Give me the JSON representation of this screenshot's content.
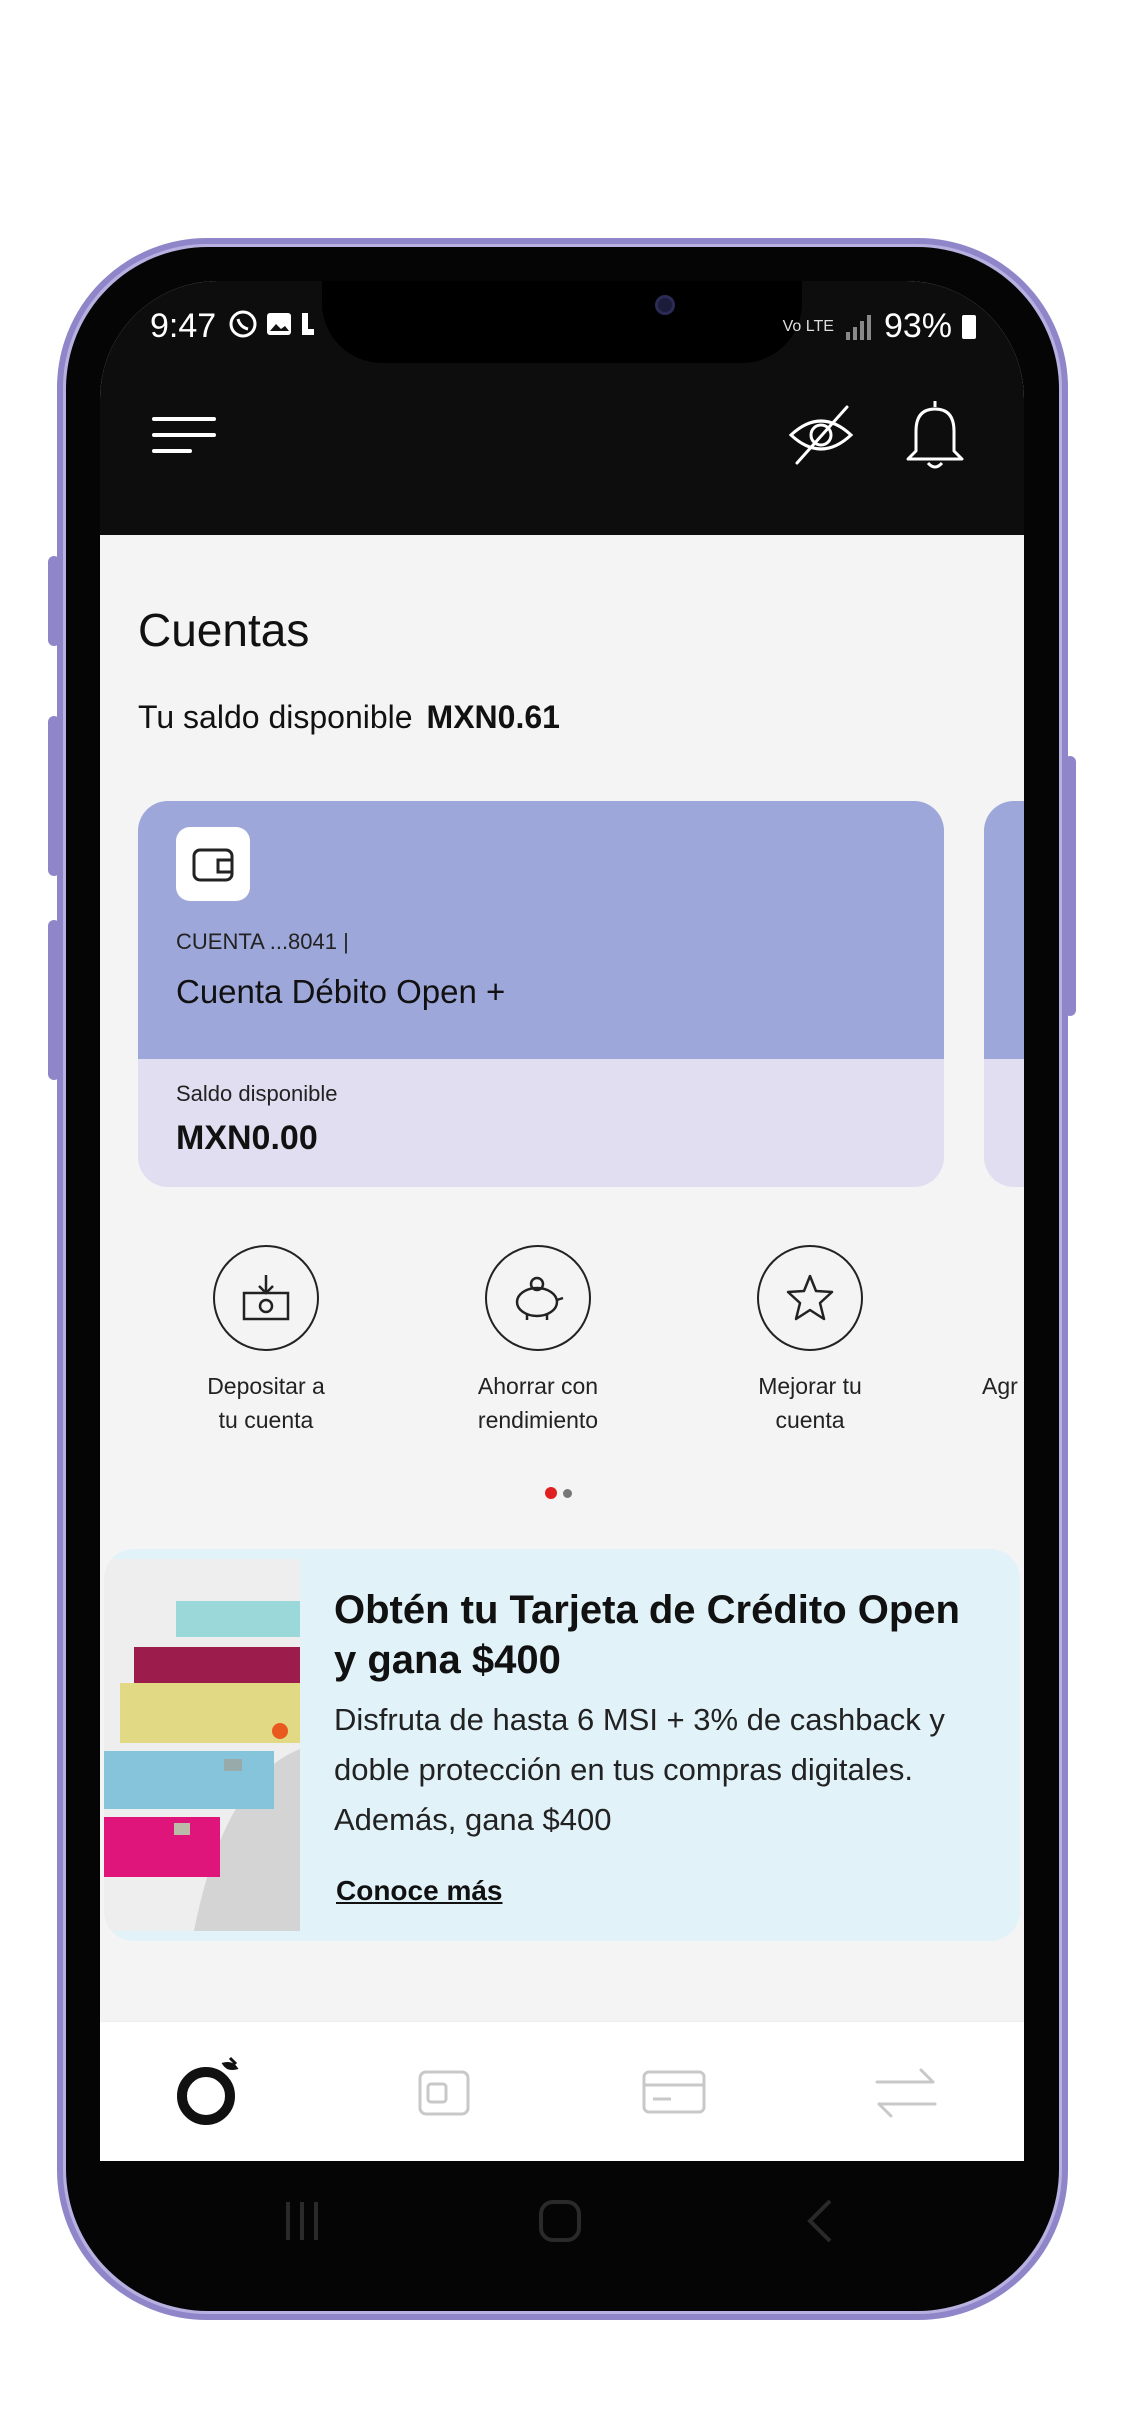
{
  "status_bar": {
    "time": "9:47",
    "battery": "93%",
    "network": "Vo LTE"
  },
  "header": {
    "menu_icon": "hamburger-icon",
    "hide_balance_icon": "eye-off-icon",
    "notifications_icon": "bell-icon"
  },
  "accounts": {
    "title": "Cuentas",
    "balance_label": "Tu saldo disponible",
    "balance_value": "MXN0.61"
  },
  "account_card": {
    "number": "CUENTA ...8041 |",
    "name": "Cuenta Débito Open +",
    "balance_label": "Saldo disponible",
    "balance_value": "MXN0.00",
    "icon": "wallet-icon",
    "colors": {
      "top": "#9ea7d9",
      "bottom": "#e0def0"
    }
  },
  "quick_actions": [
    {
      "label_line1": "Depositar a",
      "label_line2": "tu cuenta",
      "icon": "deposit-icon"
    },
    {
      "label_line1": "Ahorrar con",
      "label_line2": "rendimiento",
      "icon": "piggy-bank-icon"
    },
    {
      "label_line1": "Mejorar tu",
      "label_line2": "cuenta",
      "icon": "star-icon"
    },
    {
      "label_line1": "Agr",
      "label_line2": "",
      "icon": "add-icon"
    }
  ],
  "carousel": {
    "active_index": 0,
    "count": 2,
    "active_color": "#e02020"
  },
  "promo": {
    "title_line1": "Obtén tu Tarjeta de Crédito Open",
    "title_line2": "y gana $400",
    "body_line1": "Disfruta de hasta 6 MSI + 3% de cashback y",
    "body_line2": "doble protección en tus compras digitales.",
    "body_line3": "Además, gana $400",
    "link": "Conoce más",
    "background": "#e1f2f9"
  },
  "bottom_nav": [
    {
      "icon": "home-logo-icon",
      "active": true
    },
    {
      "icon": "wallet-nav-icon",
      "active": false
    },
    {
      "icon": "card-icon",
      "active": false
    },
    {
      "icon": "transfer-icon",
      "active": false
    }
  ],
  "system_nav": [
    "recents-icon",
    "home-icon",
    "back-icon"
  ]
}
